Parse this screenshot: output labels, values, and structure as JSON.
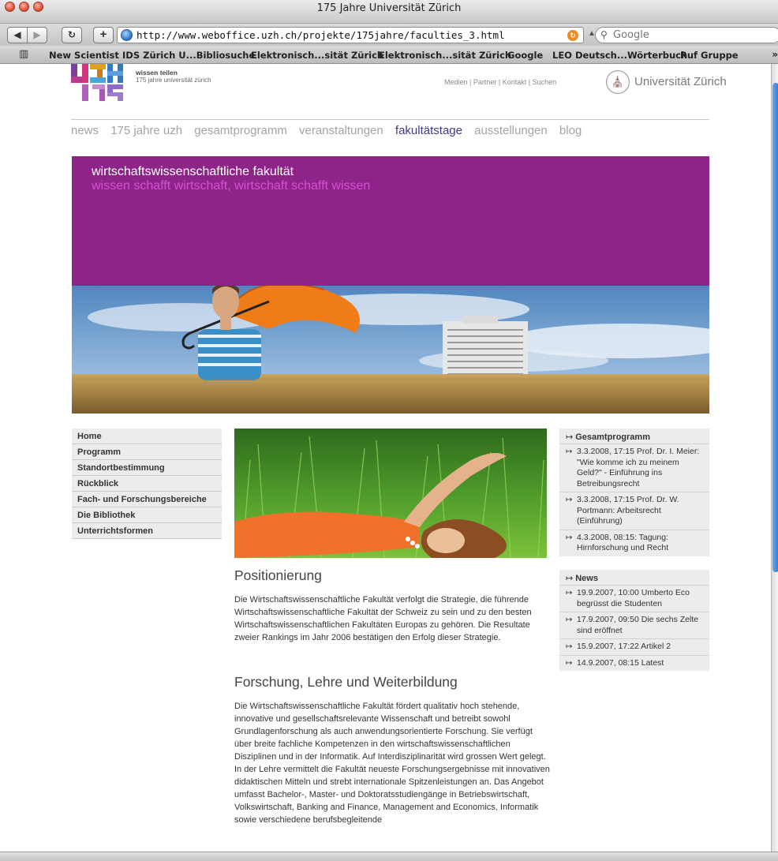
{
  "browser": {
    "window_title": "175 Jahre Universität Zürich",
    "url": "http://www.weboffice.uzh.ch/projekte/175jahre/faculties_3.html",
    "search_placeholder": "Google",
    "bookmarks": [
      "New Scientist",
      "IDS Zürich U...Bibliosuche",
      "Elektronisch...sität Zürich",
      "Elektronisch...sität Zürich",
      "Google",
      "LEO Deutsch...Wörterbuch",
      "Ruf Gruppe"
    ],
    "bookmarks_more": "»"
  },
  "header": {
    "tagline_strong": "wissen teilen",
    "tagline_small": "175 jahre universität zürich",
    "top_links": [
      "Medien",
      "Partner",
      "Kontakt",
      "Suchen"
    ],
    "university_name": "Universität Zürich"
  },
  "mainnav": [
    "news",
    "175 jahre uzh",
    "gesamtprogramm",
    "veranstaltungen",
    "fakultätstage",
    "ausstellungen",
    "blog"
  ],
  "mainnav_active": "fakultätstage",
  "banner": {
    "title": "wirtschaftswissenschaftliche fakultät",
    "subtitle": "wissen schafft wirtschaft, wirtschaft schafft wissen"
  },
  "leftnav": [
    "Home",
    "Programm",
    "Standortbestimmung",
    "Rückblick",
    "Fach- und Forschungsbereiche",
    "Die Bibliothek",
    "Unterrichtsformen"
  ],
  "content": {
    "h1": "Positionierung",
    "p1": "Die Wirtschaftswissenschaftliche Fakultät verfolgt die Strategie, die führende Wirtschaftswissenschaftliche Fakultät der Schweiz zu sein und zu den besten Wirtschaftswissenschaftlichen Fakultäten Europas zu gehören. Die Resultate zweier Rankings im Jahr 2006 bestätigen den Erfolg dieser Strategie.",
    "h2": "Forschung, Lehre und Weiterbildung",
    "p2": "Die Wirtschaftswissenschaftliche Fakultät fördert qualitativ hoch stehende, innovative und gesellschaftsrelevante Wissenschaft und betreibt sowohl Grundlagenforschung als auch anwendungsorientierte Forschung. Sie verfügt über breite fachliche Kompetenzen in den wirtschaftswissenschaftlichen Disziplinen und in der Informatik. Auf Interdisziplinarität wird grossen Wert gelegt. In der Lehre vermittelt die Fakultät neueste Forschungsergebnisse mit innovativen didaktischen Mitteln und strebt internationale Spitzenleistungen an. Das Angebot umfasst Bachelor-, Master- und Doktoratsstudiengänge in Betriebswirtschaft, Volkswirtschaft, Banking and Finance, Management and Economics, Informatik sowie verschiedene berufsbegleitende"
  },
  "sidebar": {
    "arrow": "↦",
    "programm_title": "Gesamtprogramm",
    "programm": [
      "3.3.2008, 17:15 Prof. Dr. I. Meier: \"Wie komme ich zu meinem Geld?\" - Einführung ins Betreibungsrecht",
      "3.3.2008, 17:15 Prof. Dr. W. Portmann: Arbeitsrecht (Einführung)",
      "4.3.2008, 08:15: Tagung: Hirnforschung und Recht"
    ],
    "news_title": "News",
    "news": [
      "19.9.2007, 10:00 Umberto Eco begrüsst die Studenten",
      "17.9.2007, 09:50 Die sechs Zelte sind eröffnet",
      "15.9.2007, 17:22 Artikel 2",
      "14.9.2007, 08:15 Latest"
    ]
  },
  "colors": {
    "banner_bg": "#8e2388",
    "banner_subtitle": "#d64fd4",
    "nav_active": "#3e3a86",
    "nav_inactive": "#a3a3a3"
  }
}
